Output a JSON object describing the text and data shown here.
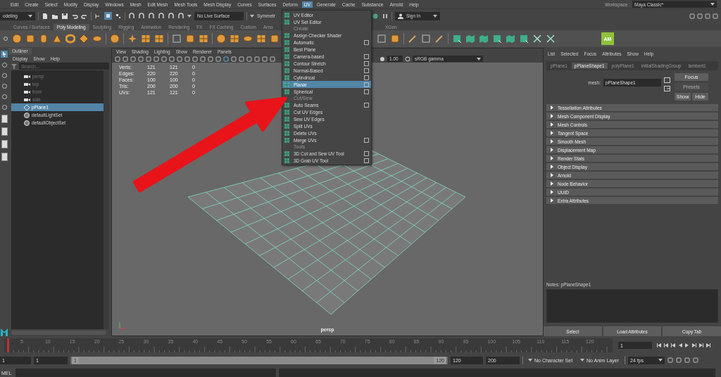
{
  "menu_bar": {
    "items": [
      {
        "label": "Edit",
        "selected": false
      },
      {
        "label": "Create",
        "selected": false
      },
      {
        "label": "Select",
        "selected": false
      },
      {
        "label": "Modify",
        "selected": false
      },
      {
        "label": "Display",
        "selected": false
      },
      {
        "label": "Windows",
        "selected": false
      },
      {
        "label": "Mesh",
        "selected": false
      },
      {
        "label": "Edit Mesh",
        "selected": false
      },
      {
        "label": "Mesh Tools",
        "selected": false
      },
      {
        "label": "Mesh Display",
        "selected": false
      },
      {
        "label": "Curves",
        "selected": false
      },
      {
        "label": "Surfaces",
        "selected": false
      },
      {
        "label": "Deform",
        "selected": false
      },
      {
        "label": "UV",
        "selected": true
      },
      {
        "label": "Generate",
        "selected": false
      },
      {
        "label": "Cache",
        "selected": false
      },
      {
        "label": "Substance",
        "selected": false
      },
      {
        "label": "Arnold",
        "selected": false
      },
      {
        "label": "Help",
        "selected": false
      }
    ],
    "workspace_label": "Workspace :",
    "workspace": "Maya Classic*"
  },
  "status_line": {
    "menu_set": "odeling",
    "live_surface": "No Live Surface",
    "symmetry": "Symmetr",
    "sign_in": "Sign In"
  },
  "shelf": {
    "tabs": [
      {
        "label": "Curves / Surfaces",
        "selected": false
      },
      {
        "label": "Poly Modeling",
        "selected": true
      },
      {
        "label": "Sculpting",
        "selected": false
      },
      {
        "label": "Rigging",
        "selected": false
      },
      {
        "label": "Animation",
        "selected": false
      },
      {
        "label": "Rendering",
        "selected": false
      },
      {
        "label": "FX",
        "selected": false
      },
      {
        "label": "FX Caching",
        "selected": false
      },
      {
        "label": "Custom",
        "selected": false
      },
      {
        "label": "Arno",
        "selected": false
      }
    ],
    "tabs_right": [
      {
        "label": "XGen",
        "selected": false
      }
    ],
    "badge": "AM"
  },
  "outliner": {
    "title": "Outliner",
    "menu": [
      "Display",
      "Show",
      "Help"
    ],
    "search": {
      "placeholder": "Search..."
    },
    "items": [
      {
        "label": "persp",
        "kind": "camera",
        "selected": false
      },
      {
        "label": "top",
        "kind": "camera",
        "selected": false
      },
      {
        "label": "front",
        "kind": "camera",
        "selected": false
      },
      {
        "label": "side",
        "kind": "camera",
        "selected": false
      },
      {
        "label": "pPlane1",
        "kind": "mesh",
        "selected": true
      },
      {
        "label": "defaultLightSet",
        "kind": "set",
        "selected": false
      },
      {
        "label": "defaultObjectSet",
        "kind": "set",
        "selected": false
      }
    ]
  },
  "viewport": {
    "menu": [
      "View",
      "Shading",
      "Lighting",
      "Show",
      "Renderer",
      "Panels"
    ],
    "exposure": "1.00",
    "color_space": "sRGB gamma",
    "hud": [
      {
        "label": "Verts:",
        "values": [
          "121",
          "121",
          "0"
        ]
      },
      {
        "label": "Edges:",
        "values": [
          "220",
          "220",
          "0"
        ]
      },
      {
        "label": "Faces:",
        "values": [
          "100",
          "100",
          "0"
        ]
      },
      {
        "label": "Tris:",
        "values": [
          "200",
          "200",
          "0"
        ]
      },
      {
        "label": "UVs:",
        "values": [
          "121",
          "121",
          "0"
        ]
      }
    ],
    "camera": "persp"
  },
  "uv_menu": {
    "items": [
      {
        "kind": "item",
        "label": "UV Editor",
        "option_box": false,
        "selected": false
      },
      {
        "kind": "item",
        "label": "UV Set Editor",
        "option_box": false,
        "selected": false
      },
      {
        "kind": "header",
        "label": "Create"
      },
      {
        "kind": "item",
        "label": "Assign Checker Shader",
        "option_box": false,
        "selected": false
      },
      {
        "kind": "item",
        "label": "Automatic",
        "option_box": true,
        "selected": false
      },
      {
        "kind": "item",
        "label": "Best Plane",
        "option_box": false,
        "selected": false
      },
      {
        "kind": "item",
        "label": "Camera-based",
        "option_box": true,
        "selected": false
      },
      {
        "kind": "item",
        "label": "Contour Stretch",
        "option_box": true,
        "selected": false
      },
      {
        "kind": "item",
        "label": "Normal-Based",
        "option_box": true,
        "selected": false
      },
      {
        "kind": "item",
        "label": "Cylindrical",
        "option_box": true,
        "selected": false
      },
      {
        "kind": "item",
        "label": "Planar",
        "option_box": true,
        "selected": true
      },
      {
        "kind": "item",
        "label": "Spherical",
        "option_box": true,
        "selected": false
      },
      {
        "kind": "header",
        "label": "Cut/Sew"
      },
      {
        "kind": "item",
        "label": "Auto Seams",
        "option_box": true,
        "selected": false
      },
      {
        "kind": "item",
        "label": "Cut UV Edges",
        "option_box": false,
        "selected": false
      },
      {
        "kind": "item",
        "label": "Sew UV Edges",
        "option_box": false,
        "selected": false
      },
      {
        "kind": "item",
        "label": "Split UVs",
        "option_box": false,
        "selected": false
      },
      {
        "kind": "item",
        "label": "Delete UVs",
        "option_box": false,
        "selected": false
      },
      {
        "kind": "item",
        "label": "Merge UVs",
        "option_box": true,
        "selected": false
      },
      {
        "kind": "header",
        "label": "Tools"
      },
      {
        "kind": "item",
        "label": "3D Cut and Sew UV Tool",
        "option_box": true,
        "selected": false
      },
      {
        "kind": "item",
        "label": "3D Grab UV Tool",
        "option_box": true,
        "selected": false
      }
    ]
  },
  "attribute_editor": {
    "menu": [
      "List",
      "Selected",
      "Focus",
      "Attributes",
      "Show",
      "Help"
    ],
    "tabs": [
      {
        "label": "pPlane1",
        "selected": false
      },
      {
        "label": "pPlaneShape1",
        "selected": true
      },
      {
        "label": "polyPlane1",
        "selected": false
      },
      {
        "label": "initialShadingGroup",
        "selected": false
      },
      {
        "label": "lambert1",
        "selected": false
      }
    ],
    "node_type": "mesh:",
    "node_name": "pPlaneShape1",
    "buttons": [
      {
        "label": "Focus",
        "disabled": false
      },
      {
        "label": "Presets",
        "disabled": true
      },
      {
        "label": "Show",
        "disabled": false
      },
      {
        "label": "Hide",
        "disabled": false
      }
    ],
    "sections": [
      "Tessellation Attributes",
      "Mesh Component Display",
      "Mesh Controls",
      "Tangent Space",
      "Smooth Mesh",
      "Displacement Map",
      "Render Stats",
      "Object Display",
      "Arnold",
      "Node Behavior",
      "UUID",
      "Extra Attributes"
    ],
    "notes_label": "Notes: pPlaneShape1",
    "footer_buttons": [
      "Select",
      "Load Attributes",
      "Copy Tab"
    ]
  },
  "timeline": {
    "ticks": [
      "5",
      "10",
      "15",
      "20",
      "25",
      "30",
      "35",
      "40",
      "45",
      "50",
      "55",
      "60",
      "65",
      "70",
      "75",
      "80",
      "85",
      "90",
      "95",
      "100",
      "105",
      "110",
      "115",
      "120"
    ],
    "current_frame": "1",
    "level": 0
  },
  "range": {
    "start": "1",
    "playback_start": "1",
    "level": 1,
    "slider_start": "1",
    "slider_end": "120",
    "playback_end": "120",
    "end": "200",
    "character_set": "No Character Set",
    "anim_layer": "No Anim Layer",
    "fps": "24 fps"
  },
  "command_line": {
    "label": "MEL"
  }
}
